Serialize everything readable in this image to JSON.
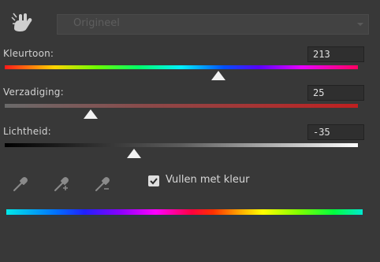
{
  "header": {
    "preset_label": "Origineel"
  },
  "hue": {
    "label": "Kleurtoon:",
    "value": "213",
    "level": 0.605
  },
  "saturation": {
    "label": "Verzadiging:",
    "value": "25",
    "level": 0.243
  },
  "lightness": {
    "label": "Lichtheid:",
    "value": "-35",
    "level": 0.365
  },
  "options": {
    "colorize_label": "Vullen met kleur",
    "colorize_checked": true
  },
  "colors": {
    "panel_bg": "#383838",
    "text": "#d2d2d2",
    "saturation_track": "#b83030"
  }
}
